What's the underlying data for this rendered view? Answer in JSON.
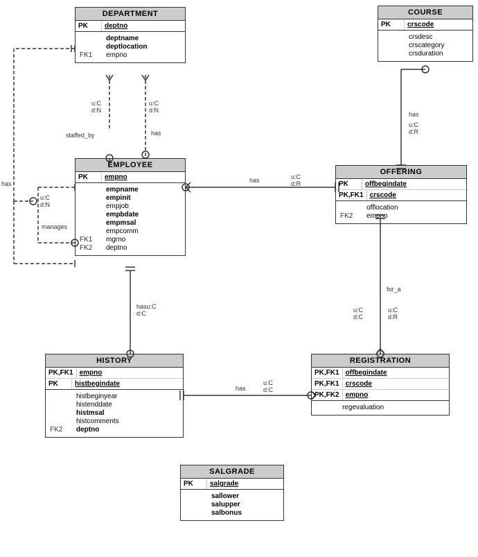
{
  "entities": {
    "department": {
      "title": "DEPARTMENT",
      "pk": [
        {
          "label": "PK",
          "field": "deptno",
          "underline": true
        }
      ],
      "attrs": [
        {
          "fk": "",
          "name": "deptname",
          "bold": true
        },
        {
          "fk": "",
          "name": "deptlocation",
          "bold": true
        },
        {
          "fk": "FK1",
          "name": "empno",
          "bold": false
        }
      ]
    },
    "employee": {
      "title": "EMPLOYEE",
      "pk": [
        {
          "label": "PK",
          "field": "empno",
          "underline": true
        }
      ],
      "attrs": [
        {
          "fk": "",
          "name": "empname",
          "bold": true
        },
        {
          "fk": "",
          "name": "empinit",
          "bold": true
        },
        {
          "fk": "",
          "name": "empjob",
          "bold": false
        },
        {
          "fk": "",
          "name": "empbdate",
          "bold": true
        },
        {
          "fk": "",
          "name": "empmsal",
          "bold": true
        },
        {
          "fk": "",
          "name": "empcomm",
          "bold": false
        },
        {
          "fk": "FK1",
          "name": "mgrno",
          "bold": false
        },
        {
          "fk": "FK2",
          "name": "deptno",
          "bold": false
        }
      ]
    },
    "course": {
      "title": "COURSE",
      "pk": [
        {
          "label": "PK",
          "field": "crscode",
          "underline": true
        }
      ],
      "attrs": [
        {
          "fk": "",
          "name": "crsdesc",
          "bold": false
        },
        {
          "fk": "",
          "name": "crscategory",
          "bold": false
        },
        {
          "fk": "",
          "name": "crsduration",
          "bold": false
        }
      ]
    },
    "offering": {
      "title": "OFFERING",
      "pk": [
        {
          "label": "PK",
          "field": "offbegindate",
          "underline": true
        },
        {
          "label": "PK,FK1",
          "field": "crscode",
          "underline": true
        }
      ],
      "attrs": [
        {
          "fk": "FK2",
          "name": "offlocation",
          "bold": false
        },
        {
          "fk": "",
          "name": "empno",
          "bold": false
        }
      ]
    },
    "history": {
      "title": "HISTORY",
      "pk": [
        {
          "label": "PK,FK1",
          "field": "empno",
          "underline": true
        },
        {
          "label": "PK",
          "field": "histbegindate",
          "underline": true
        }
      ],
      "attrs": [
        {
          "fk": "",
          "name": "histbeginyear",
          "bold": false
        },
        {
          "fk": "",
          "name": "histenddate",
          "bold": false
        },
        {
          "fk": "",
          "name": "histmsal",
          "bold": true
        },
        {
          "fk": "",
          "name": "histcomments",
          "bold": false
        },
        {
          "fk": "FK2",
          "name": "deptno",
          "bold": false
        }
      ]
    },
    "registration": {
      "title": "REGISTRATION",
      "pk": [
        {
          "label": "PK,FK1",
          "field": "offbegindate",
          "underline": true
        },
        {
          "label": "PK,FK1",
          "field": "crscode",
          "underline": true
        },
        {
          "label": "PK,FK2",
          "field": "empno",
          "underline": true
        }
      ],
      "attrs": [
        {
          "fk": "",
          "name": "regevaluation",
          "bold": false
        }
      ]
    },
    "salgrade": {
      "title": "SALGRADE",
      "pk": [
        {
          "label": "PK",
          "field": "salgrade",
          "underline": true
        }
      ],
      "attrs": [
        {
          "fk": "",
          "name": "sallower",
          "bold": true
        },
        {
          "fk": "",
          "name": "salupper",
          "bold": true
        },
        {
          "fk": "",
          "name": "salbonus",
          "bold": true
        }
      ]
    }
  },
  "labels": {
    "staffed_by": "staffed_by",
    "has_dept_emp": "has",
    "has_emp_offering": "has",
    "has_emp_history": "has",
    "manages": "manages",
    "has_left": "has",
    "for_a": "for_a",
    "uC_dR_1": "u:C\nd:R",
    "uC_dN_1": "u:C\nd:N",
    "uC_dN_2": "u:C\nd:N",
    "uC_dR_2": "u:C\nd:R",
    "hasu_dC": "hasu:C\nd:C",
    "uC_dC": "u:C\nd:C",
    "uC_dR_3": "u:C\nd:R"
  }
}
